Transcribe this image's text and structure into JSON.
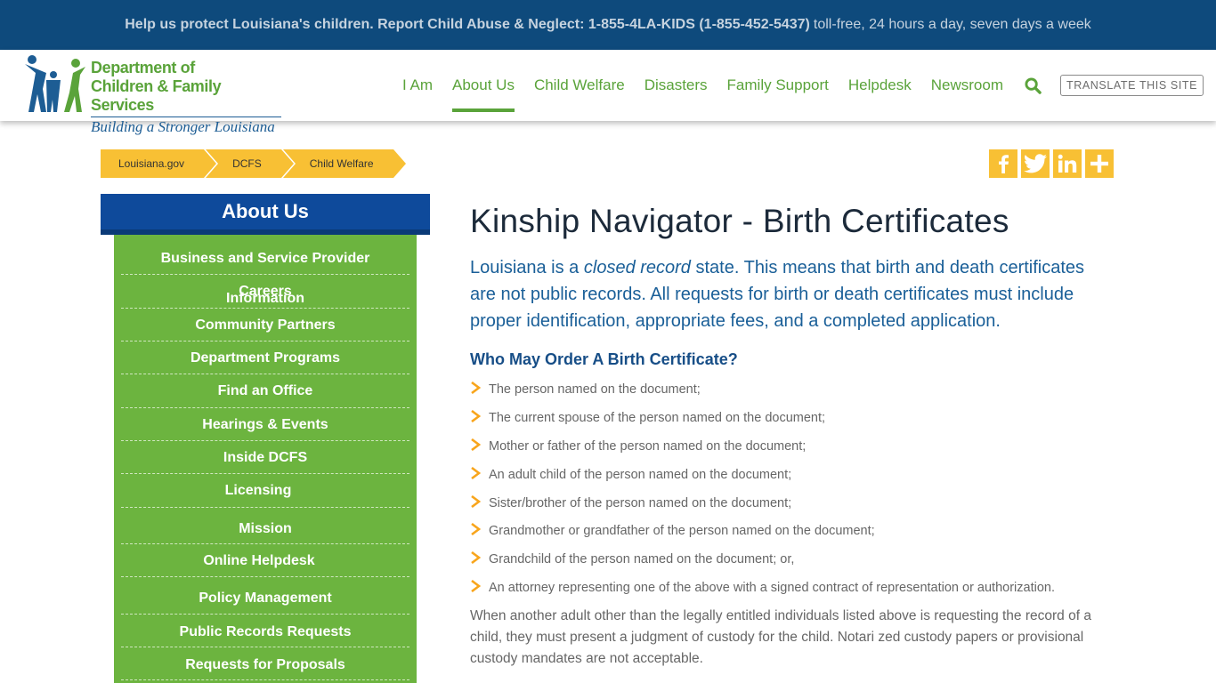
{
  "alert": {
    "strong": "Help us protect Louisiana's children. Report Child Abuse & Neglect: 1-855-4LA-KIDS (1-855-452-5437)",
    "light": "toll-free, 24 hours a day, seven days a week"
  },
  "logo": {
    "line1": "Department of",
    "line2": "Children & Family Services",
    "line3": "Building a Stronger Louisiana"
  },
  "nav": {
    "items": [
      {
        "label": "I Am"
      },
      {
        "label": "About Us",
        "active": true
      },
      {
        "label": "Child Welfare"
      },
      {
        "label": "Disasters"
      },
      {
        "label": "Family Support"
      },
      {
        "label": "Helpdesk"
      },
      {
        "label": "Newsroom"
      }
    ],
    "search_icon": "search-icon",
    "translate_label": "TRANSLATE THIS SITE"
  },
  "breadcrumb": [
    "Louisiana.gov",
    "DCFS",
    "Child Welfare"
  ],
  "social": [
    "facebook-icon",
    "twitter-icon",
    "linkedin-icon",
    "plus-icon"
  ],
  "sidebar": {
    "title": "About Us",
    "items": [
      "Business and Service Provider Information",
      "Careers",
      "Community Partners",
      "Department Programs",
      "Find an Office",
      "Hearings & Events",
      "Inside DCFS",
      "Licensing",
      "Mission",
      "Online Helpdesk",
      "Policy Management",
      "Public Records Requests",
      "Requests for Proposals"
    ]
  },
  "main": {
    "title": "Kinship Navigator - Birth Certificates",
    "lead_pre": "Louisiana is a ",
    "lead_em": "closed record",
    "lead_post": " state. This means that birth and death certificates are not public records. All requests for birth or death certificates must include proper identification, appropriate fees, and a completed application.",
    "section_title": "Who May Order A Birth Certificate?",
    "list": [
      "The person named on the document;",
      "The current spouse of the person named on the document;",
      "Mother or father of the person named on the document;",
      "An adult child of the person named on the document;",
      "Sister/brother of the person named on the document;",
      "Grandmother or grandfather of the person named on the document;",
      "Grandchild of the person named on the document; or,",
      "An attorney representing one of the above with a signed contract of representation or authorization."
    ],
    "paragraph": "When another adult other than the legally entitled individuals listed above is requesting the record of a child, they must present a judgment of custody for the child. Notari zed custody papers or provisional custody mandates are not acceptable."
  },
  "colors": {
    "alert_bg": "#0e4a7c",
    "brand_green": "#5aa33a",
    "sidebar_green": "#6cb43f",
    "sidebar_title_blue": "#0e4a9b",
    "accent_yellow": "#f8c034",
    "lead_blue": "#1a5f98"
  }
}
